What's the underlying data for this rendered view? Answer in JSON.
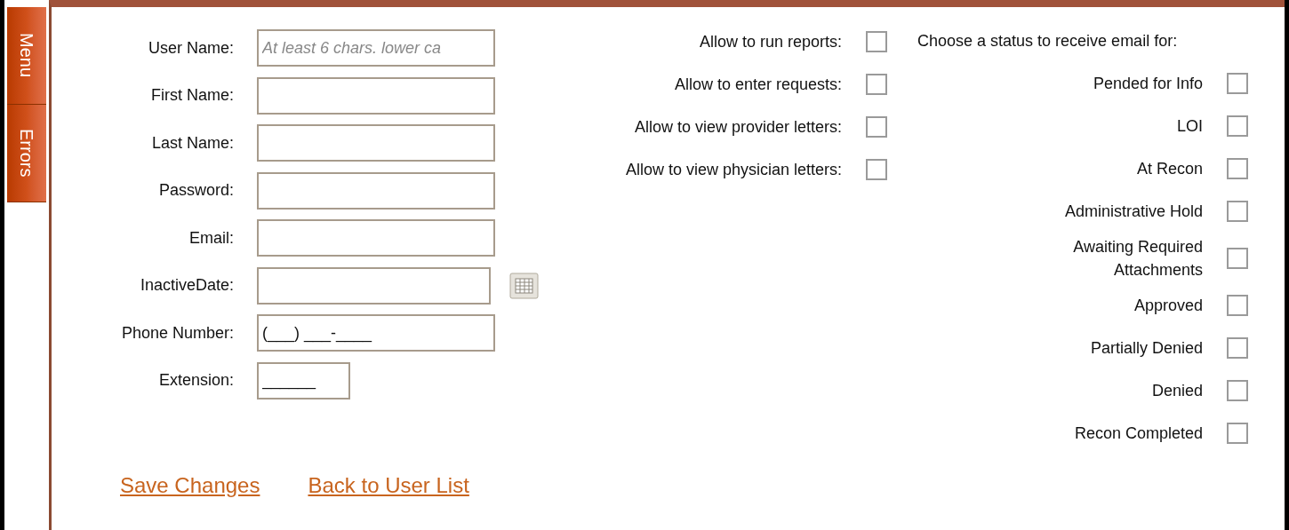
{
  "side_tabs": [
    {
      "label": "Menu"
    },
    {
      "label": "Errors"
    }
  ],
  "fields": [
    {
      "label": "User Name:",
      "kind": "text",
      "placeholder": "At least 6 chars. lower ca"
    },
    {
      "label": "First Name:",
      "kind": "text"
    },
    {
      "label": "Last Name:",
      "kind": "text"
    },
    {
      "label": "Password:",
      "kind": "text"
    },
    {
      "label": "Email:",
      "kind": "text"
    },
    {
      "label": "InactiveDate:",
      "kind": "date"
    },
    {
      "label": "Phone Number:",
      "kind": "text",
      "value": "(___) ___-____"
    },
    {
      "label": "Extension:",
      "kind": "short",
      "value": "______"
    }
  ],
  "permissions": [
    {
      "label": "Allow to run reports:",
      "checked": false
    },
    {
      "label": "Allow to enter requests:",
      "checked": false
    },
    {
      "label": "Allow to view provider letters:",
      "checked": false
    },
    {
      "label": "Allow to view physician letters:",
      "checked": false
    }
  ],
  "status_email": {
    "heading": "Choose a status to receive email for:",
    "statuses": [
      {
        "label": "Pended for Info",
        "checked": false
      },
      {
        "label": "LOI",
        "checked": false
      },
      {
        "label": "At Recon",
        "checked": false
      },
      {
        "label": "Administrative Hold",
        "checked": false
      },
      {
        "label": "Awaiting Required Attachments",
        "checked": false
      },
      {
        "label": "Approved",
        "checked": false
      },
      {
        "label": "Partially Denied",
        "checked": false
      },
      {
        "label": "Denied",
        "checked": false
      },
      {
        "label": "Recon Completed",
        "checked": false
      }
    ]
  },
  "links": [
    "Save Changes",
    "Back to User List"
  ]
}
